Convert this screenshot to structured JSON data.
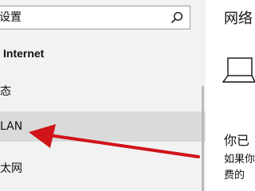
{
  "search": {
    "value": "设置"
  },
  "sidebar": {
    "heading": "Internet",
    "items": [
      {
        "label": "态",
        "selected": false
      },
      {
        "label": "LAN",
        "selected": true
      },
      {
        "label": "太网",
        "selected": false
      }
    ]
  },
  "main": {
    "title": "网络",
    "status_heading": "你已",
    "status_desc": [
      "如果你",
      "费的"
    ]
  },
  "icons": {
    "search": "search-icon",
    "device": "laptop-icon"
  },
  "colors": {
    "annotation_arrow": "#d0141a",
    "selected_item_bg": "#dadada"
  }
}
